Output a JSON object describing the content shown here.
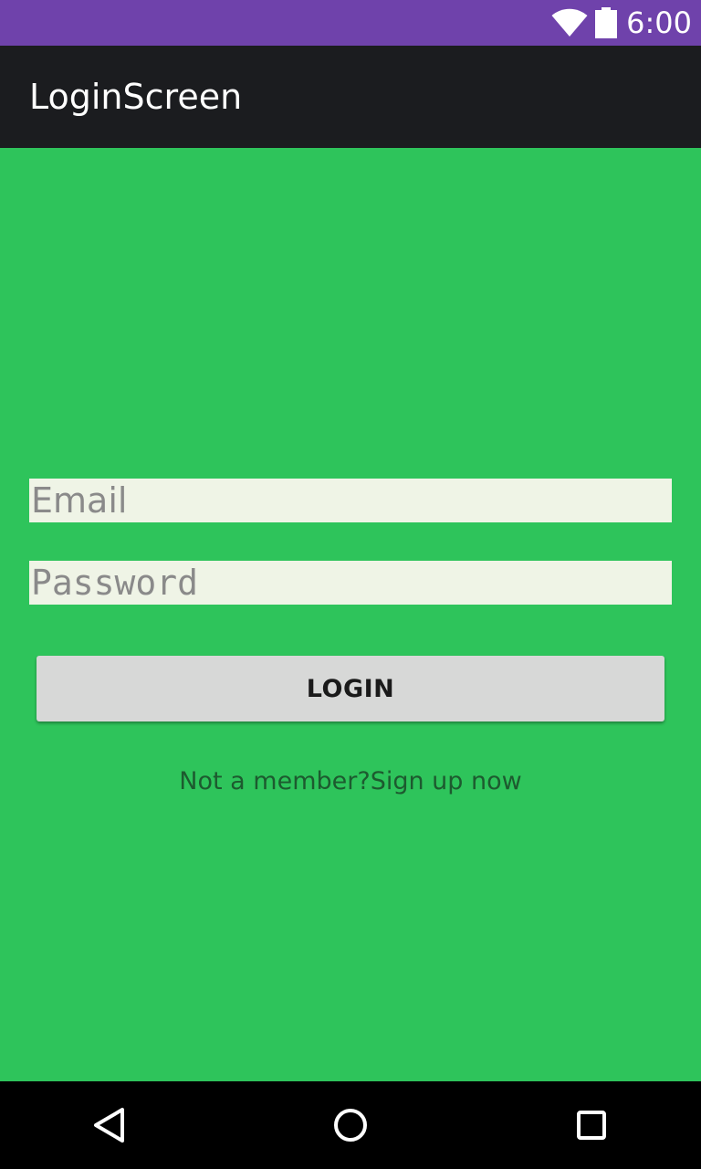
{
  "status_bar": {
    "time": "6:00",
    "background": "#6f42ab",
    "icons": [
      "wifi-icon",
      "battery-icon"
    ]
  },
  "app_bar": {
    "title": "LoginScreen",
    "background": "#1b1c1f"
  },
  "form": {
    "background": "#2ec45b",
    "email_placeholder": "Email",
    "email_value": "",
    "password_placeholder": "Password",
    "password_value": "",
    "login_label": "LOGIN",
    "signup_text": "Not a member?Sign up now"
  },
  "nav_bar": {
    "icons": [
      "back-icon",
      "home-icon",
      "recent-apps-icon"
    ]
  }
}
